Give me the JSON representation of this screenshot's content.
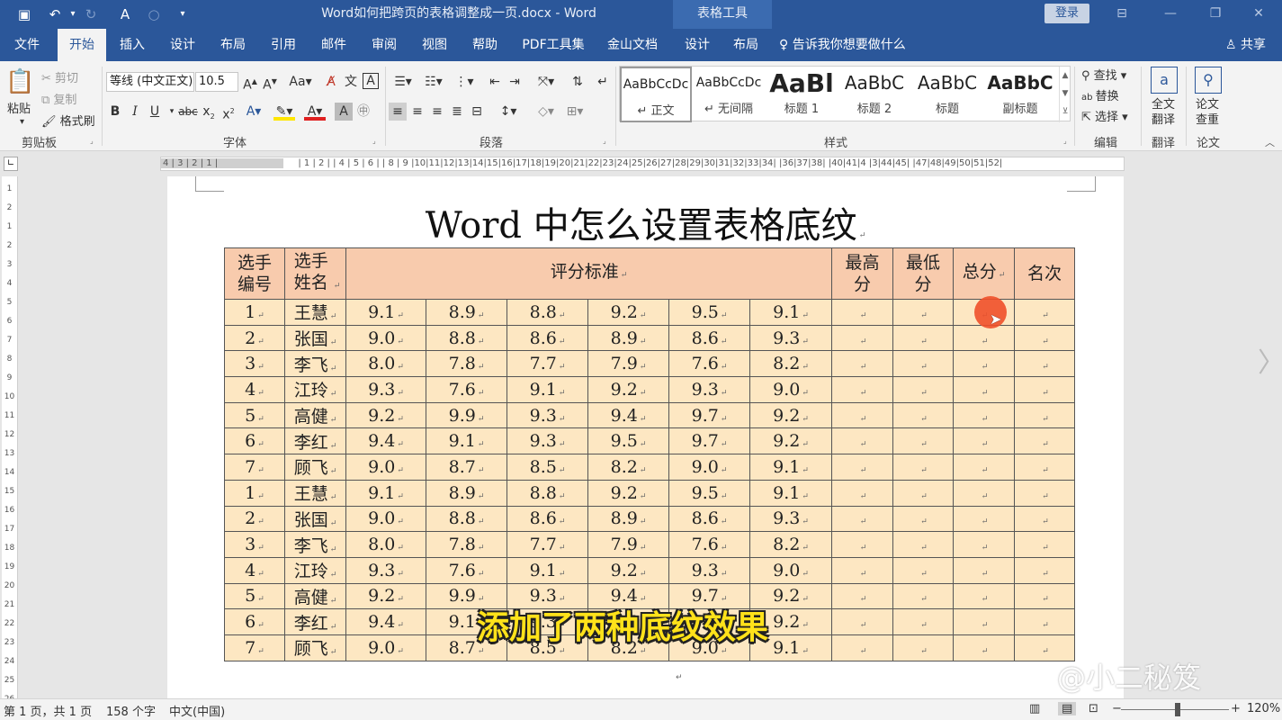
{
  "titlebar": {
    "doc_title": "Word如何把跨页的表格调整成一页.docx  -  Word",
    "context_tools": "表格工具",
    "login": "登录"
  },
  "tabs": [
    "文件",
    "开始",
    "插入",
    "设计",
    "布局",
    "引用",
    "邮件",
    "审阅",
    "视图",
    "帮助",
    "PDF工具集",
    "金山文档",
    "设计",
    "布局"
  ],
  "tellme": "告诉我你想要做什么",
  "share": "共享",
  "ribbon": {
    "clipboard": {
      "paste": "粘贴",
      "cut": "剪切",
      "copy": "复制",
      "painter": "格式刷",
      "label": "剪贴板"
    },
    "font": {
      "name": "等线 (中文正文)",
      "size": "10.5",
      "label": "字体"
    },
    "paragraph": {
      "label": "段落"
    },
    "styles": {
      "label": "样式",
      "items": [
        {
          "preview": "AaBbCcDc",
          "name": "↵ 正文"
        },
        {
          "preview": "AaBbCcDc",
          "name": "↵ 无间隔"
        },
        {
          "preview": "AaBl",
          "name": "标题 1"
        },
        {
          "preview": "AaBbC",
          "name": "标题 2"
        },
        {
          "preview": "AaBbC",
          "name": "标题"
        },
        {
          "preview": "AaBbC",
          "name": "副标题"
        }
      ]
    },
    "editing": {
      "find": "查找",
      "replace": "替换",
      "select": "选择",
      "label": "编辑"
    },
    "translate": {
      "btn": "全文\n翻译",
      "label": "翻译"
    },
    "paper": {
      "btn": "论文\n查重",
      "label": "论文"
    }
  },
  "document": {
    "heading": "Word 中怎么设置表格底纹",
    "table": {
      "headers": {
        "id": "选手编号",
        "name": "选手姓名",
        "criteria": "评分标准",
        "max": "最高分",
        "min": "最低分",
        "total": "总分",
        "rank": "名次"
      },
      "rows": [
        {
          "id": "1",
          "name": "王慧",
          "scores": [
            "9.1",
            "8.9",
            "8.8",
            "9.2",
            "9.5",
            "9.1"
          ]
        },
        {
          "id": "2",
          "name": "张国",
          "scores": [
            "9.0",
            "8.8",
            "8.6",
            "8.9",
            "8.6",
            "9.3"
          ]
        },
        {
          "id": "3",
          "name": "李飞",
          "scores": [
            "8.0",
            "7.8",
            "7.7",
            "7.9",
            "7.6",
            "8.2"
          ]
        },
        {
          "id": "4",
          "name": "江玲",
          "scores": [
            "9.3",
            "7.6",
            "9.1",
            "9.2",
            "9.3",
            "9.0"
          ]
        },
        {
          "id": "5",
          "name": "高健",
          "scores": [
            "9.2",
            "9.9",
            "9.3",
            "9.4",
            "9.7",
            "9.2"
          ]
        },
        {
          "id": "6",
          "name": "李红",
          "scores": [
            "9.4",
            "9.1",
            "9.3",
            "9.5",
            "9.7",
            "9.2"
          ]
        },
        {
          "id": "7",
          "name": "顾飞",
          "scores": [
            "9.0",
            "8.7",
            "8.5",
            "8.2",
            "9.0",
            "9.1"
          ]
        },
        {
          "id": "1",
          "name": "王慧",
          "scores": [
            "9.1",
            "8.9",
            "8.8",
            "9.2",
            "9.5",
            "9.1"
          ]
        },
        {
          "id": "2",
          "name": "张国",
          "scores": [
            "9.0",
            "8.8",
            "8.6",
            "8.9",
            "8.6",
            "9.3"
          ]
        },
        {
          "id": "3",
          "name": "李飞",
          "scores": [
            "8.0",
            "7.8",
            "7.7",
            "7.9",
            "7.6",
            "8.2"
          ]
        },
        {
          "id": "4",
          "name": "江玲",
          "scores": [
            "9.3",
            "7.6",
            "9.1",
            "9.2",
            "9.3",
            "9.0"
          ]
        },
        {
          "id": "5",
          "name": "高健",
          "scores": [
            "9.2",
            "9.9",
            "9.3",
            "9.4",
            "9.7",
            "9.2"
          ]
        },
        {
          "id": "6",
          "name": "李红",
          "scores": [
            "9.4",
            "9.1",
            "9.3",
            "9.5",
            "9.7",
            "9.2"
          ]
        },
        {
          "id": "7",
          "name": "顾飞",
          "scores": [
            "9.0",
            "8.7",
            "8.5",
            "8.2",
            "9.0",
            "9.1"
          ]
        }
      ]
    }
  },
  "overlay": {
    "subtitle": "添加了两种底纹效果",
    "watermark": "@小二秘笈"
  },
  "status": {
    "page": "第 1 页，共 1 页",
    "words": "158 个字",
    "lang": "中文(中国)",
    "zoom": "120%"
  }
}
